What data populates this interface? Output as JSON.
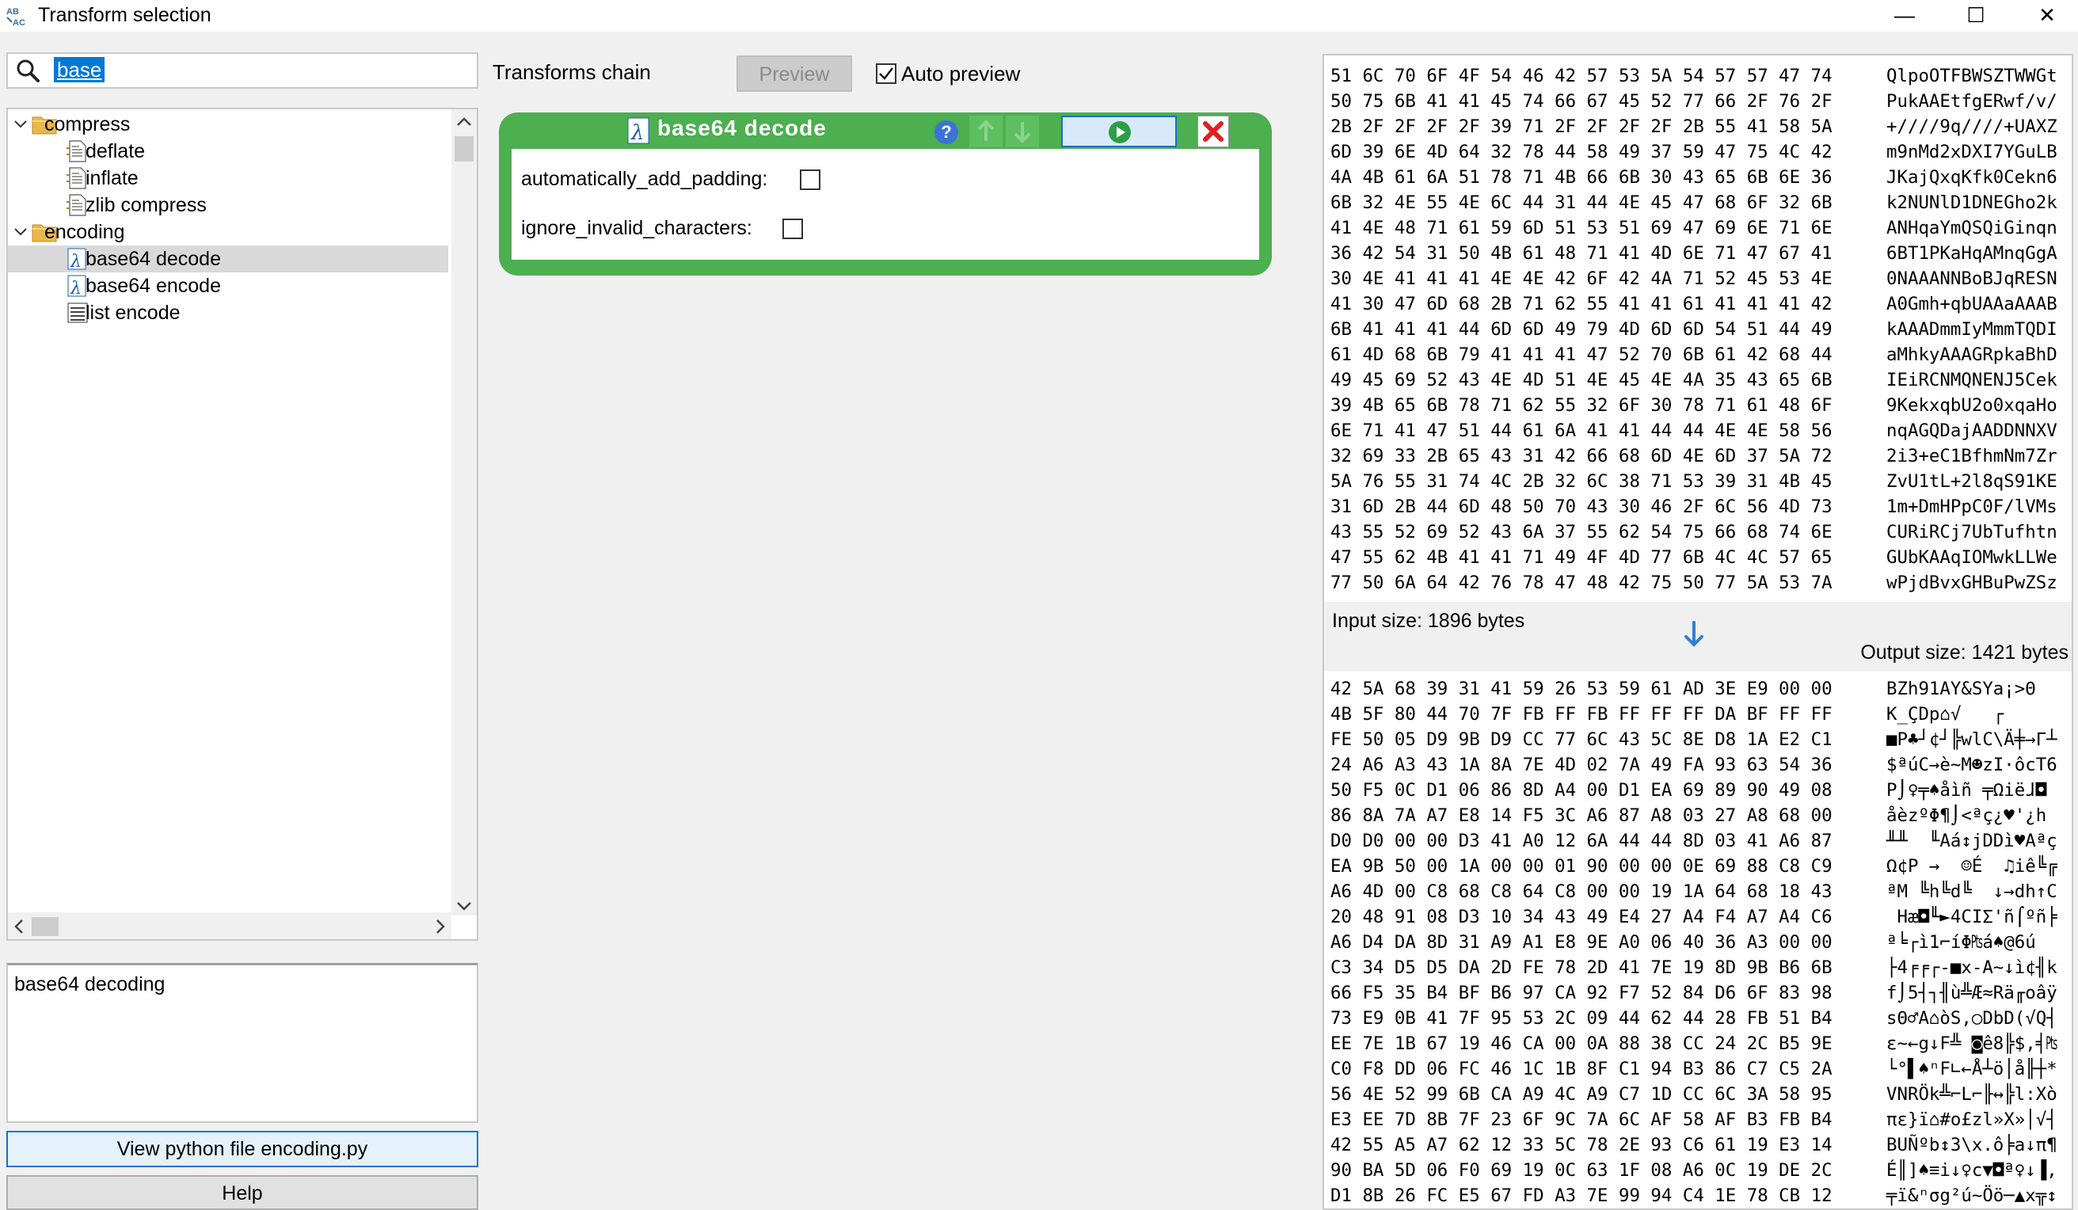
{
  "window": {
    "title": "Transform selection",
    "icon_text": "AB\n%AC",
    "minimize_glyph": "—",
    "maximize_glyph": "☐",
    "close_glyph": "✕"
  },
  "search": {
    "value": "base",
    "icon": "search-icon"
  },
  "tree": {
    "items": [
      {
        "label": "compress",
        "level": 0,
        "type": "folder",
        "expanded": true,
        "selected": false
      },
      {
        "label": "deflate",
        "level": 1,
        "type": "doc",
        "selected": false
      },
      {
        "label": "inflate",
        "level": 1,
        "type": "doc",
        "selected": false
      },
      {
        "label": "zlib compress",
        "level": 1,
        "type": "doc",
        "selected": false
      },
      {
        "label": "encoding",
        "level": 0,
        "type": "folder",
        "expanded": true,
        "selected": false
      },
      {
        "label": "base64 decode",
        "level": 1,
        "type": "lambda",
        "selected": true
      },
      {
        "label": "base64 encode",
        "level": 1,
        "type": "lambda",
        "selected": false
      },
      {
        "label": "list encode",
        "level": 1,
        "type": "list",
        "selected": false
      }
    ]
  },
  "description": "base64 decoding",
  "buttons": {
    "view_python": "View python file encoding.py",
    "help": "Help"
  },
  "chain": {
    "label": "Transforms chain",
    "preview_label": "Preview",
    "auto_preview_label": "Auto preview",
    "auto_preview_checked": true,
    "transform": {
      "title": "base64  decode",
      "help_glyph": "?",
      "params": [
        {
          "label": "automatically_add_padding:",
          "checked": false
        },
        {
          "label": "ignore_invalid_characters:",
          "checked": false
        }
      ]
    }
  },
  "io": {
    "input_size": "Input size: 1896 bytes",
    "output_size": "Output size: 1421 bytes"
  },
  "colors": {
    "accent": "#0078d7",
    "transform_green": "#4caf50",
    "close_red": "#e02020"
  },
  "input_hex": [
    {
      "hex": "51 6C 70 6F 4F 54 46 42 57 53 5A 54 57 57 47 74",
      "ascii": "QlpoOTFBWSZTWWGt"
    },
    {
      "hex": "50 75 6B 41 41 45 74 66 67 45 52 77 66 2F 76 2F",
      "ascii": "PukAAEtfgERwf/v/"
    },
    {
      "hex": "2B 2F 2F 2F 2F 39 71 2F 2F 2F 2F 2B 55 41 58 5A",
      "ascii": "+////9q////+UAXZ"
    },
    {
      "hex": "6D 39 6E 4D 64 32 78 44 58 49 37 59 47 75 4C 42",
      "ascii": "m9nMd2xDXI7YGuLB"
    },
    {
      "hex": "4A 4B 61 6A 51 78 71 4B 66 6B 30 43 65 6B 6E 36",
      "ascii": "JKajQxqKfk0Cekn6"
    },
    {
      "hex": "6B 32 4E 55 4E 6C 44 31 44 4E 45 47 68 6F 32 6B",
      "ascii": "k2NUNlD1DNEGho2k"
    },
    {
      "hex": "41 4E 48 71 61 59 6D 51 53 51 69 47 69 6E 71 6E",
      "ascii": "ANHqaYmQSQiGinqn"
    },
    {
      "hex": "36 42 54 31 50 4B 61 48 71 41 4D 6E 71 47 67 41",
      "ascii": "6BT1PKaHqAMnqGgA"
    },
    {
      "hex": "30 4E 41 41 41 4E 4E 42 6F 42 4A 71 52 45 53 4E",
      "ascii": "0NAAANNBoBJqRESN"
    },
    {
      "hex": "41 30 47 6D 68 2B 71 62 55 41 41 61 41 41 41 42",
      "ascii": "A0Gmh+qbUAAaAAAB"
    },
    {
      "hex": "6B 41 41 41 44 6D 6D 49 79 4D 6D 6D 54 51 44 49",
      "ascii": "kAAADmmIyMmmTQDI"
    },
    {
      "hex": "61 4D 68 6B 79 41 41 41 47 52 70 6B 61 42 68 44",
      "ascii": "aMhkyAAAGRpkaBhD"
    },
    {
      "hex": "49 45 69 52 43 4E 4D 51 4E 45 4E 4A 35 43 65 6B",
      "ascii": "IEiRCNMQNENJ5Cek"
    },
    {
      "hex": "39 4B 65 6B 78 71 62 55 32 6F 30 78 71 61 48 6F",
      "ascii": "9KekxqbU2o0xqaHo"
    },
    {
      "hex": "6E 71 41 47 51 44 61 6A 41 41 44 44 4E 4E 58 56",
      "ascii": "nqAGQDajAADDNNXV"
    },
    {
      "hex": "32 69 33 2B 65 43 31 42 66 68 6D 4E 6D 37 5A 72",
      "ascii": "2i3+eC1BfhmNm7Zr"
    },
    {
      "hex": "5A 76 55 31 74 4C 2B 32 6C 38 71 53 39 31 4B 45",
      "ascii": "ZvU1tL+2l8qS91KE"
    },
    {
      "hex": "31 6D 2B 44 6D 48 50 70 43 30 46 2F 6C 56 4D 73",
      "ascii": "1m+DmHPpC0F/lVMs"
    },
    {
      "hex": "43 55 52 69 52 43 6A 37 55 62 54 75 66 68 74 6E",
      "ascii": "CURiRCj7UbTufhtn"
    },
    {
      "hex": "47 55 62 4B 41 41 71 49 4F 4D 77 6B 4C 4C 57 65",
      "ascii": "GUbKAAqIOMwkLLWe"
    },
    {
      "hex": "77 50 6A 64 42 76 78 47 48 42 75 50 77 5A 53 7A",
      "ascii": "wPjdBvxGHBuPwZSz"
    }
  ],
  "output_hex": [
    {
      "hex": "42 5A 68 39 31 41 59 26 53 59 61 AD 3E E9 00 00",
      "ascii": "BZh91AY&SYa¡>Θ"
    },
    {
      "hex": "4B 5F 80 44 70 7F FB FF FB FF FF FF DA BF FF FF",
      "ascii": "K_ÇDp⌂√   ┌"
    },
    {
      "hex": "FE 50 05 D9 9B D9 CC 77 6C 43 5C 8E D8 1A E2 C1",
      "ascii": "■P♣┘¢┘╠wlC\\Ä╪→Γ┴"
    },
    {
      "hex": "24 A6 A3 43 1A 8A 7E 4D 02 7A 49 FA 93 63 54 36",
      "ascii": "$ªúC→è~M☻zI·ôcT6"
    },
    {
      "hex": "50 F5 0C D1 06 86 8D A4 00 D1 EA 69 89 90 49 08",
      "ascii": "P⌡♀╤♠åìñ ╤Ωiëɺ◘"
    },
    {
      "hex": "86 8A 7A A7 E8 14 F5 3C A6 87 A8 03 27 A8 68 00",
      "ascii": "åèzºΦ¶⌡<ªç¿♥'¿h"
    },
    {
      "hex": "D0 D0 00 00 D3 41 A0 12 6A 44 44 8D 03 41 A6 87",
      "ascii": "╨╨  ╙Aá↕jDDì♥Aªç"
    },
    {
      "hex": "EA 9B 50 00 1A 00 00 01 90 00 00 0E 69 88 C8 C9",
      "ascii": "Ω¢P →  ☺É  ♫iê╚╔"
    },
    {
      "hex": "A6 4D 00 C8 68 C8 64 C8 00 00 19 1A 64 68 18 43",
      "ascii": "ªM ╚h╚d╚  ↓→dh↑C"
    },
    {
      "hex": "20 48 91 08 D3 10 34 43 49 E4 27 A4 F4 A7 A4 C6",
      "ascii": " Hæ◘╙►4CIΣ'ñ⌠ºñ╞"
    },
    {
      "hex": "A6 D4 DA 8D 31 A9 A1 E8 9E A0 06 40 36 A3 00 00",
      "ascii": "ª╘┌ì1⌐íΦ₧á♠@6ú"
    },
    {
      "hex": "C3 34 D5 D5 DA 2D FE 78 2D 41 7E 19 8D 9B B6 6B",
      "ascii": "├4╒╒┌-■x-A~↓ì¢╢k"
    },
    {
      "hex": "66 F5 35 B4 BF B6 97 CA 92 F7 52 84 D6 6F 83 98",
      "ascii": "f⌡5┤┐╢ù╩Æ≈Rä╓oâÿ"
    },
    {
      "hex": "73 E9 0B 41 7F 95 53 2C 09 44 62 44 28 FB 51 B4",
      "ascii": "sΘ♂A⌂òS,○DbD(√Q┤"
    },
    {
      "hex": "EE 7E 1B 67 19 46 CA 00 0A 88 38 CC 24 2C B5 9E",
      "ascii": "ε~←g↓F╩ ◙ê8╠$,╡₧"
    },
    {
      "hex": "C0 F8 DD 06 FC 46 1C 1B 8F C1 94 B3 86 C7 C5 2A",
      "ascii": "└°▌♠ⁿF∟←Å┴ö│å╟┼*"
    },
    {
      "hex": "56 4E 52 99 6B CA A9 4C A9 C7 1D CC 6C 3A 58 95",
      "ascii": "VNRÖk╩⌐L⌐╟↔╠l:Xò"
    },
    {
      "hex": "E3 EE 7D 8B 7F 23 6F 9C 7A 6C AF 58 AF B3 FB B4",
      "ascii": "πε}ï⌂#o£zl»X»│√┤"
    },
    {
      "hex": "42 55 A5 A7 62 12 33 5C 78 2E 93 C6 61 19 E3 14",
      "ascii": "BUÑºb↕3\\x.ô╞a↓π¶"
    },
    {
      "hex": "90 BA 5D 06 F0 69 19 0C 63 1F 08 A6 0C 19 DE 2C",
      "ascii": "É║]♠≡i↓♀c▼◘ª♀↓▐,"
    },
    {
      "hex": "D1 8B 26 FC E5 67 FD A3 7E 99 94 C4 1E 78 CB 12",
      "ascii": "╤ï&ⁿσg²ú~Öö─▲x╦↕"
    }
  ]
}
